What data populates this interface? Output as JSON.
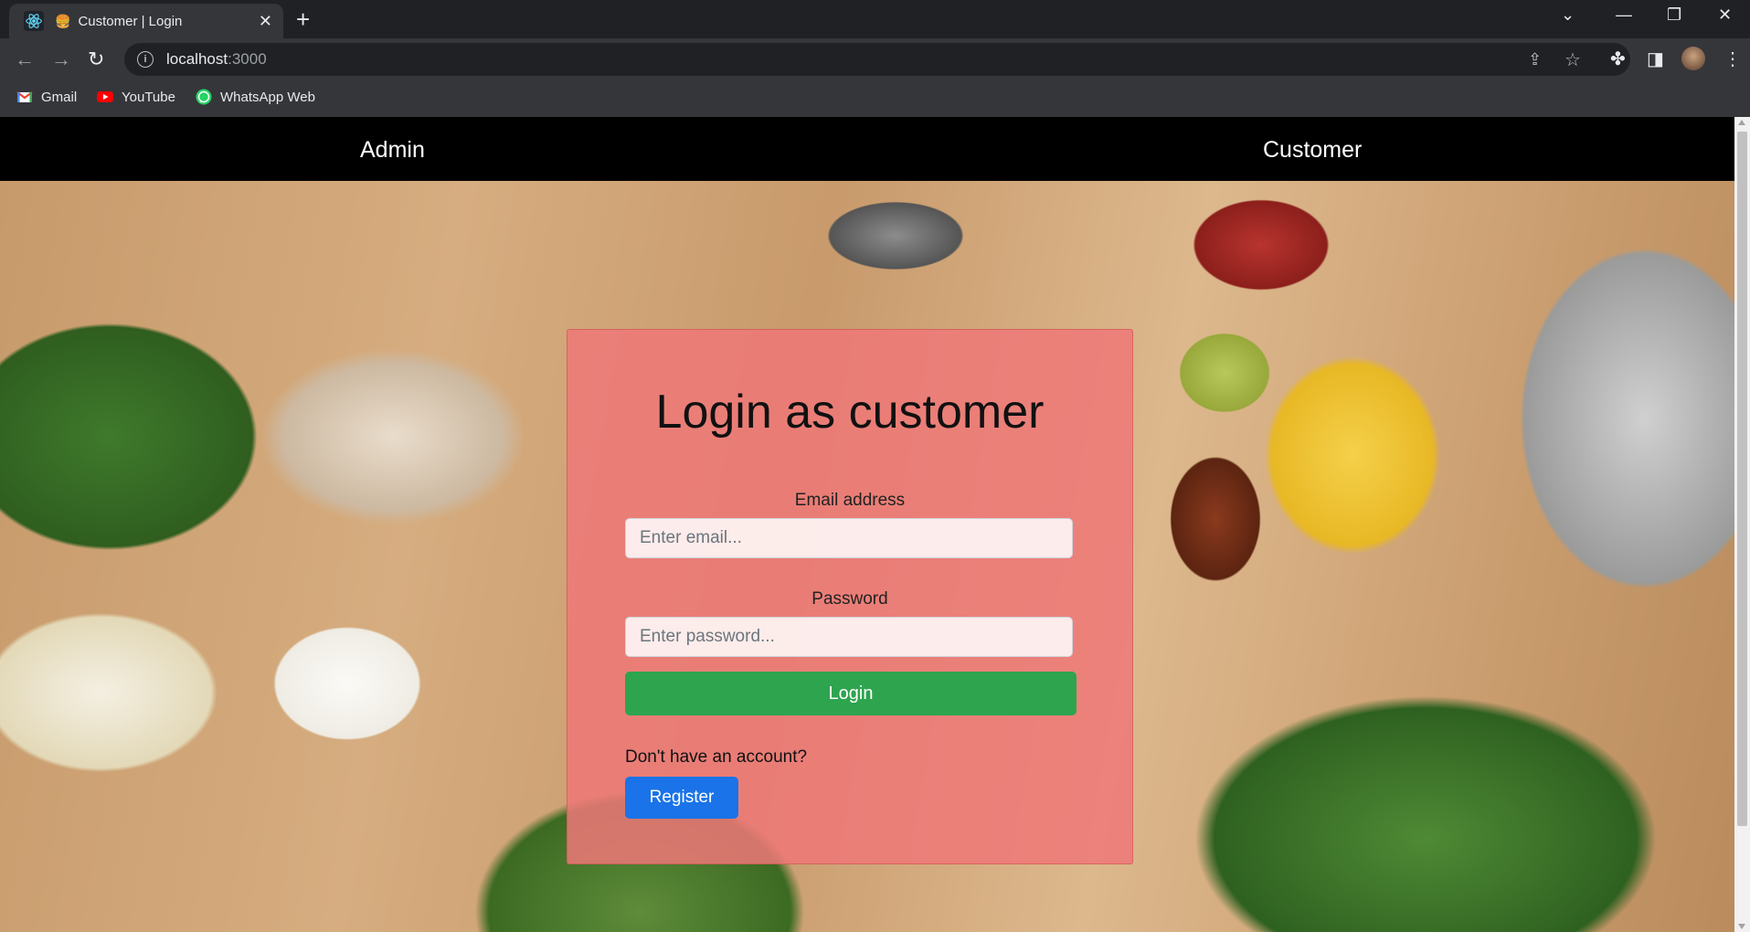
{
  "browser": {
    "tab_title": "Customer | Login",
    "url_host": "localhost",
    "url_port": ":3000",
    "bookmarks": [
      {
        "label": "Gmail",
        "icon": "gmail-icon"
      },
      {
        "label": "YouTube",
        "icon": "youtube-icon"
      },
      {
        "label": "WhatsApp Web",
        "icon": "whatsapp-icon"
      }
    ]
  },
  "navbar": {
    "admin_label": "Admin",
    "customer_label": "Customer"
  },
  "login": {
    "heading": "Login as customer",
    "email_label": "Email address",
    "email_placeholder": "Enter email...",
    "password_label": "Password",
    "password_placeholder": "Enter password...",
    "login_button": "Login",
    "no_account_text": "Don't have an account?",
    "register_button": "Register"
  },
  "colors": {
    "card_bg": "#ee7878",
    "login_button": "#2ea44f",
    "register_button": "#1a73e8",
    "navbar_bg": "#000000"
  }
}
